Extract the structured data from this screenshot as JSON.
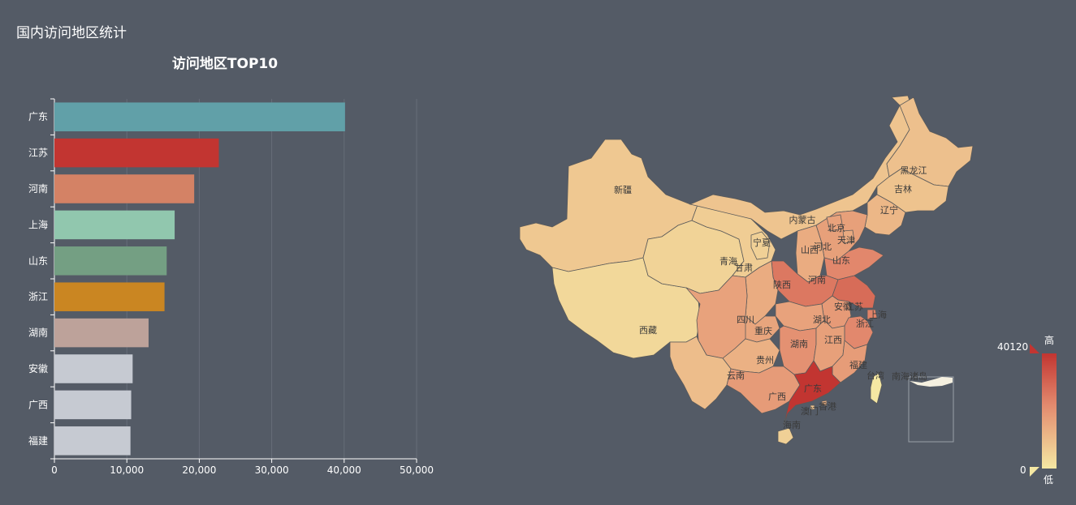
{
  "page": {
    "title": "国内访问地区统计"
  },
  "colors": {
    "background": "#545b66",
    "grid": "#666d78",
    "axis": "#ffffff",
    "map_low": "#f5e8a3",
    "map_high": "#c23531",
    "map_border": "#5a5a5a"
  },
  "chart_data": [
    {
      "type": "bar",
      "orientation": "horizontal",
      "title": "访问地区TOP10",
      "categories": [
        "广东",
        "江苏",
        "河南",
        "上海",
        "山东",
        "浙江",
        "湖南",
        "安徽",
        "广西",
        "福建"
      ],
      "values": [
        40120,
        22700,
        19300,
        16600,
        15500,
        15200,
        13000,
        10800,
        10600,
        10500
      ],
      "bar_colors": [
        "#61a0a8",
        "#c23531",
        "#d48265",
        "#91c7ae",
        "#749f83",
        "#ca8622",
        "#bda29a",
        "#c6cad2",
        "#c6cad2",
        "#c6cad2"
      ],
      "xlim": [
        0,
        50000
      ],
      "x_ticks": [
        0,
        10000,
        20000,
        30000,
        40000,
        50000
      ],
      "x_tick_labels": [
        "0",
        "10,000",
        "20,000",
        "30,000",
        "40,000",
        "50,000"
      ],
      "grid": true
    },
    {
      "type": "heatmap",
      "subtype": "choropleth-map",
      "regions": [
        "新疆",
        "西藏",
        "青海",
        "甘肃",
        "宁夏",
        "内蒙古",
        "黑龙江",
        "吉林",
        "辽宁",
        "北京",
        "天津",
        "河北",
        "山西",
        "山东",
        "河南",
        "陕西",
        "四川",
        "重庆",
        "湖北",
        "安徽",
        "江苏",
        "上海",
        "浙江",
        "湖南",
        "江西",
        "贵州",
        "云南",
        "广西",
        "广东",
        "福建",
        "台湾",
        "香港",
        "澳门",
        "海南",
        "南海诸岛"
      ],
      "values": [
        2500,
        800,
        1200,
        1800,
        1500,
        3000,
        3500,
        3200,
        5000,
        9000,
        7500,
        9500,
        7000,
        15500,
        19300,
        7000,
        9000,
        8500,
        9000,
        10800,
        22700,
        16600,
        15200,
        13000,
        9500,
        6000,
        4000,
        10600,
        40120,
        10500,
        0,
        6000,
        3000,
        1500,
        0
      ],
      "visual_map": {
        "min": 0,
        "max": 40120,
        "min_label": "0",
        "max_label": "40120",
        "text_high": "高",
        "text_low": "低"
      }
    }
  ]
}
